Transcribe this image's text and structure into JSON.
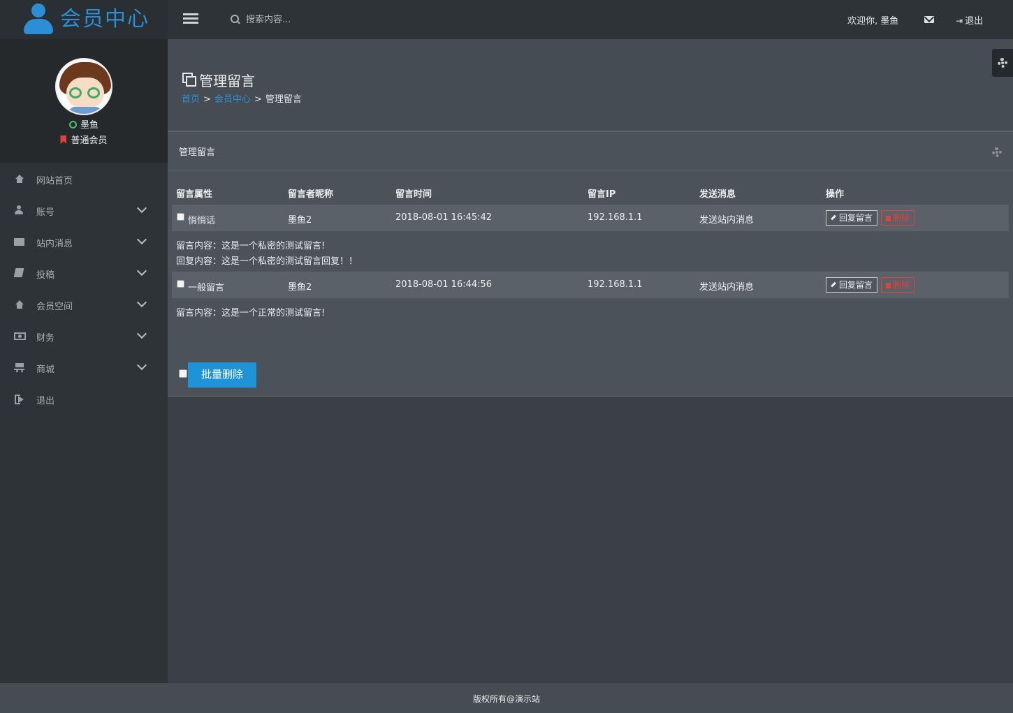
{
  "app": {
    "title": "会员中心"
  },
  "topbar": {
    "search_placeholder": "搜索内容...",
    "welcome": "欢迎你, 墨鱼",
    "logout": "退出"
  },
  "profile": {
    "name": "墨鱼",
    "level": "普通会员"
  },
  "sidebar": {
    "items": [
      {
        "label": "网站首页",
        "icon": "home-icon",
        "expandable": false
      },
      {
        "label": "账号",
        "icon": "user-icon",
        "expandable": true
      },
      {
        "label": "站内消息",
        "icon": "envelope-icon",
        "expandable": true
      },
      {
        "label": "投稿",
        "icon": "book-icon",
        "expandable": true
      },
      {
        "label": "会员空间",
        "icon": "home-icon",
        "expandable": true
      },
      {
        "label": "财务",
        "icon": "money-icon",
        "expandable": true
      },
      {
        "label": "商城",
        "icon": "cart-icon",
        "expandable": true
      },
      {
        "label": "退出",
        "icon": "sign-out-icon",
        "expandable": false
      }
    ]
  },
  "page": {
    "title": "管理留言",
    "breadcrumb": {
      "home": "首页",
      "sep1": ">",
      "member": "会员中心",
      "sep2": ">",
      "current": "管理留言"
    }
  },
  "panel": {
    "title": "管理留言",
    "columns": [
      "留言属性",
      "留言者昵称",
      "留言时间",
      "留言IP",
      "发送消息",
      "操作"
    ],
    "rows": [
      {
        "type": "悄悄话",
        "nickname": "墨鱼2",
        "time": "2018-08-01 16:45:42",
        "ip": "192.168.1.1",
        "send": "发送站内消息",
        "reply_label": "回复留言",
        "delete_label": "删除",
        "content": "留言内容：这是一个私密的测试留言!",
        "reply": "回复内容：这是一个私密的测试留言回复！！"
      },
      {
        "type": "一般留言",
        "nickname": "墨鱼2",
        "time": "2018-08-01 16:44:56",
        "ip": "192.168.1.1",
        "send": "发送站内消息",
        "reply_label": "回复留言",
        "delete_label": "删除",
        "content": "留言内容：这是一个正常的测试留言!"
      }
    ],
    "batch_delete": "批量删除"
  },
  "footer": {
    "text": "版权所有@演示站"
  },
  "colors": {
    "accent": "#1f93d8",
    "danger": "#e2403f",
    "online": "#4ec16d"
  }
}
